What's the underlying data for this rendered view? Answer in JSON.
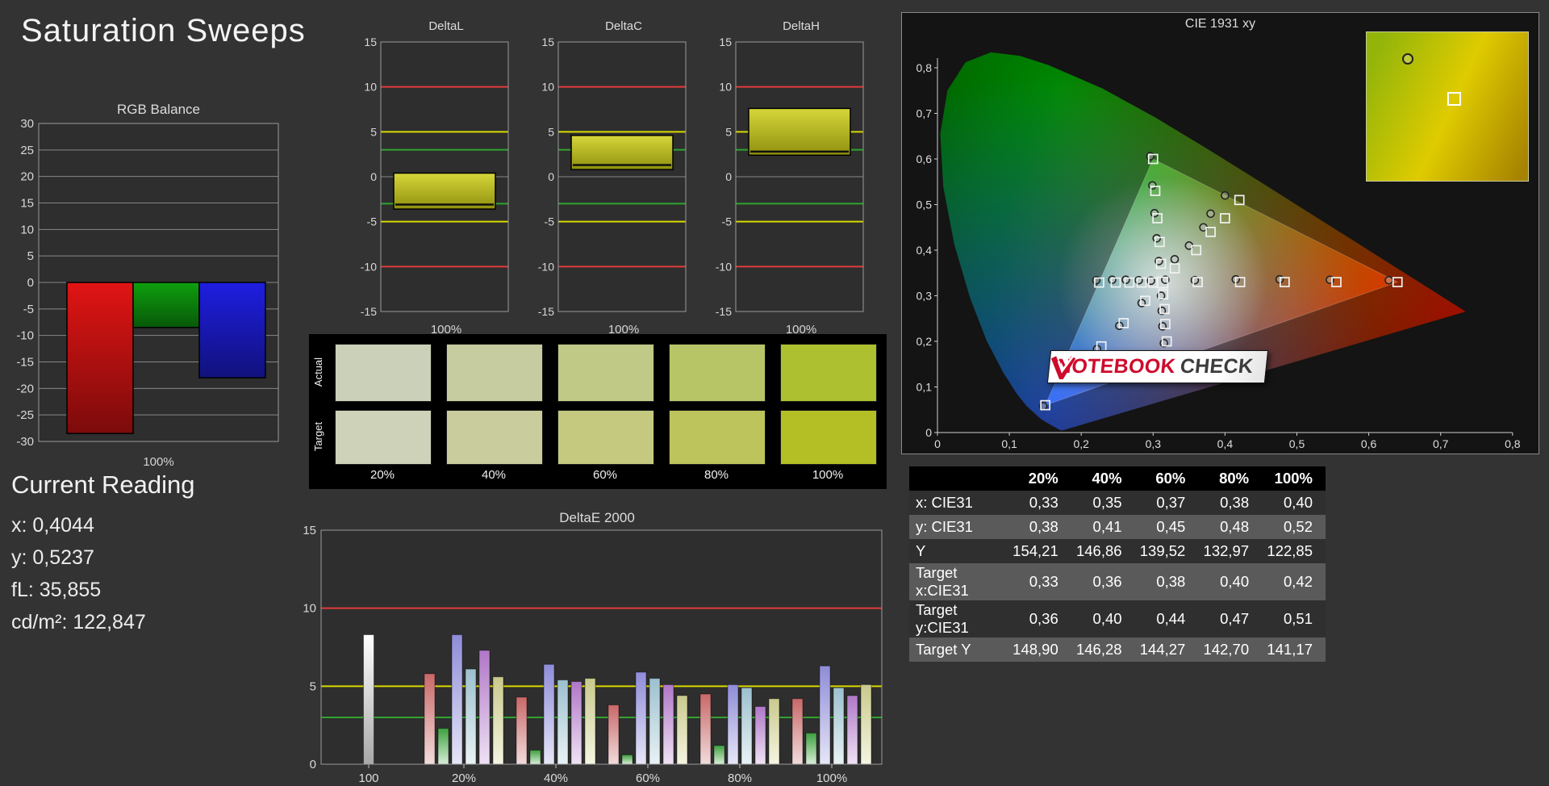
{
  "title": "Saturation Sweeps",
  "current_reading": {
    "heading": "Current Reading",
    "lines": [
      {
        "label": "x:",
        "value": "0,4044"
      },
      {
        "label": "y:",
        "value": "0,5237"
      },
      {
        "label": "fL:",
        "value": "35,855"
      },
      {
        "label": "cd/m²:",
        "value": "122,847"
      }
    ]
  },
  "swatch_panel": {
    "row_labels": [
      "Actual",
      "Target"
    ],
    "column_labels": [
      "20%",
      "40%",
      "60%",
      "80%",
      "100%"
    ],
    "actual_colors": [
      "#cbd1b8",
      "#c6cc9f",
      "#c0c985",
      "#b8c566",
      "#adc02f"
    ],
    "target_colors": [
      "#ced2b9",
      "#c9cc9c",
      "#c4c97f",
      "#bdc45b",
      "#b4bf25"
    ]
  },
  "results_table": {
    "header": [
      "",
      "20%",
      "40%",
      "60%",
      "80%",
      "100%"
    ],
    "rows": [
      {
        "label": "x: CIE31",
        "values": [
          "0,33",
          "0,35",
          "0,37",
          "0,38",
          "0,40"
        ]
      },
      {
        "label": "y: CIE31",
        "values": [
          "0,38",
          "0,41",
          "0,45",
          "0,48",
          "0,52"
        ]
      },
      {
        "label": "Y",
        "values": [
          "154,21",
          "146,86",
          "139,52",
          "132,97",
          "122,85"
        ]
      },
      {
        "label": "Target x:CIE31",
        "values": [
          "0,33",
          "0,36",
          "0,38",
          "0,40",
          "0,42"
        ]
      },
      {
        "label": "Target y:CIE31",
        "values": [
          "0,36",
          "0,40",
          "0,44",
          "0,47",
          "0,51"
        ]
      },
      {
        "label": "Target Y",
        "values": [
          "148,90",
          "146,28",
          "144,27",
          "142,70",
          "141,17"
        ]
      }
    ]
  },
  "logo": {
    "text_red": "NOTEBOOK",
    "text_dark": "CHECK",
    "red": "#cf0a2c"
  },
  "chart_data": [
    {
      "id": "rgb_balance",
      "type": "bar",
      "title": "RGB Balance",
      "xlabel": "100%",
      "categories": [
        "Red",
        "Green",
        "Blue"
      ],
      "values": [
        -28.5,
        -8.5,
        -18
      ],
      "bar_colors": [
        "#e11414",
        "#0ea00e",
        "#1e1ee1"
      ],
      "ylim": [
        -30,
        30
      ],
      "ytick_step": 5
    },
    {
      "id": "delta_l",
      "type": "range",
      "title": "DeltaL",
      "xlabel": "100%",
      "range_min": -3.6,
      "range_max": 0.4,
      "marker": -3.1,
      "ylim": [
        -15,
        15
      ],
      "ytick_step": 5,
      "box_color": "#c8c832",
      "ref_lines": [
        {
          "value": 10,
          "color": "#e23b3b"
        },
        {
          "value": -10,
          "color": "#e23b3b"
        },
        {
          "value": 5,
          "color": "#d9d900"
        },
        {
          "value": -5,
          "color": "#d9d900"
        },
        {
          "value": 3,
          "color": "#30a330"
        },
        {
          "value": -3,
          "color": "#30a330"
        }
      ]
    },
    {
      "id": "delta_c",
      "type": "range",
      "title": "DeltaC",
      "xlabel": "100%",
      "range_min": 0.8,
      "range_max": 4.6,
      "marker": 1.3,
      "ylim": [
        -15,
        15
      ],
      "ytick_step": 5,
      "box_color": "#c8c832",
      "ref_lines": [
        {
          "value": 10,
          "color": "#e23b3b"
        },
        {
          "value": -10,
          "color": "#e23b3b"
        },
        {
          "value": 5,
          "color": "#d9d900"
        },
        {
          "value": -5,
          "color": "#d9d900"
        },
        {
          "value": 3,
          "color": "#30a330"
        },
        {
          "value": -3,
          "color": "#30a330"
        }
      ]
    },
    {
      "id": "delta_h",
      "type": "range",
      "title": "DeltaH",
      "xlabel": "100%",
      "range_min": 2.4,
      "range_max": 7.6,
      "marker": 2.8,
      "ylim": [
        -15,
        15
      ],
      "ytick_step": 5,
      "box_color": "#c8c832",
      "ref_lines": [
        {
          "value": 10,
          "color": "#e23b3b"
        },
        {
          "value": -10,
          "color": "#e23b3b"
        },
        {
          "value": 5,
          "color": "#d9d900"
        },
        {
          "value": -5,
          "color": "#d9d900"
        },
        {
          "value": 3,
          "color": "#30a330"
        },
        {
          "value": -3,
          "color": "#30a330"
        }
      ]
    },
    {
      "id": "deltae_2000",
      "type": "grouped_bar",
      "title": "DeltaE 2000",
      "ylim": [
        0,
        15
      ],
      "yticks": [
        0,
        5,
        10,
        15
      ],
      "ref_lines": [
        {
          "value": 3,
          "color": "#30a330"
        },
        {
          "value": 5,
          "color": "#d9d900"
        },
        {
          "value": 10,
          "color": "#e23b3b"
        }
      ],
      "palette": {
        "white": [
          "#ffffff",
          "#a8a8a8"
        ],
        "red": [
          "#c96868",
          "#f2dcdc"
        ],
        "green": [
          "#3fa03f",
          "#d8eed8"
        ],
        "blue": [
          "#8f8cd8",
          "#e6e6f7"
        ],
        "cyan": [
          "#9cc0cf",
          "#e9f2f5"
        ],
        "magenta": [
          "#b077c7",
          "#efe2f4"
        ],
        "yellow": [
          "#c9c98d",
          "#f5f5e2"
        ]
      },
      "groups": [
        {
          "label": "100",
          "bars": [
            {
              "name": "white",
              "value": 8.3
            }
          ]
        },
        {
          "label": "20%",
          "bars": [
            {
              "name": "red",
              "value": 5.8
            },
            {
              "name": "green",
              "value": 2.3
            },
            {
              "name": "blue",
              "value": 8.3
            },
            {
              "name": "cyan",
              "value": 6.1
            },
            {
              "name": "magenta",
              "value": 7.3
            },
            {
              "name": "yellow",
              "value": 5.6
            }
          ]
        },
        {
          "label": "40%",
          "bars": [
            {
              "name": "red",
              "value": 4.3
            },
            {
              "name": "green",
              "value": 0.9
            },
            {
              "name": "blue",
              "value": 6.4
            },
            {
              "name": "cyan",
              "value": 5.4
            },
            {
              "name": "magenta",
              "value": 5.3
            },
            {
              "name": "yellow",
              "value": 5.5
            }
          ]
        },
        {
          "label": "60%",
          "bars": [
            {
              "name": "red",
              "value": 3.8
            },
            {
              "name": "green",
              "value": 0.6
            },
            {
              "name": "blue",
              "value": 5.9
            },
            {
              "name": "cyan",
              "value": 5.5
            },
            {
              "name": "magenta",
              "value": 5.1
            },
            {
              "name": "yellow",
              "value": 4.4
            }
          ]
        },
        {
          "label": "80%",
          "bars": [
            {
              "name": "red",
              "value": 4.5
            },
            {
              "name": "green",
              "value": 1.2
            },
            {
              "name": "blue",
              "value": 5.1
            },
            {
              "name": "cyan",
              "value": 4.9
            },
            {
              "name": "magenta",
              "value": 3.7
            },
            {
              "name": "yellow",
              "value": 4.2
            }
          ]
        },
        {
          "label": "100%",
          "bars": [
            {
              "name": "red",
              "value": 4.2
            },
            {
              "name": "green",
              "value": 2.0
            },
            {
              "name": "blue",
              "value": 6.3
            },
            {
              "name": "cyan",
              "value": 4.9
            },
            {
              "name": "magenta",
              "value": 4.4
            },
            {
              "name": "yellow",
              "value": 5.1
            }
          ]
        }
      ]
    },
    {
      "id": "cie_1931",
      "type": "scatter",
      "title": "CIE 1931 xy",
      "xlim": [
        0,
        0.8
      ],
      "ylim": [
        0,
        0.8
      ],
      "x_tick_labels": [
        "0",
        "0,1",
        "0,2",
        "0,3",
        "0,4",
        "0,5",
        "0,6",
        "0,7",
        "0,8"
      ],
      "y_tick_labels": [
        "0",
        "0,1",
        "0,2",
        "0,3",
        "0,4",
        "0,5",
        "0,6",
        "0,7",
        "0,8"
      ],
      "gamut_triangle": [
        [
          0.64,
          0.33
        ],
        [
          0.3,
          0.6
        ],
        [
          0.15,
          0.06
        ]
      ],
      "white_point": {
        "target": [
          0.313,
          0.329
        ],
        "measured": [
          0.317,
          0.335
        ]
      },
      "series": [
        {
          "name": "red",
          "targets": [
            [
              0.362,
              0.33
            ],
            [
              0.421,
              0.33
            ],
            [
              0.483,
              0.33
            ],
            [
              0.555,
              0.33
            ],
            [
              0.64,
              0.33
            ]
          ],
          "measured": [
            [
              0.358,
              0.334
            ],
            [
              0.415,
              0.336
            ],
            [
              0.476,
              0.336
            ],
            [
              0.546,
              0.335
            ],
            [
              0.628,
              0.334
            ]
          ]
        },
        {
          "name": "green",
          "targets": [
            [
              0.311,
              0.37
            ],
            [
              0.309,
              0.418
            ],
            [
              0.306,
              0.47
            ],
            [
              0.303,
              0.53
            ],
            [
              0.3,
              0.6
            ]
          ],
          "measured": [
            [
              0.308,
              0.376
            ],
            [
              0.305,
              0.426
            ],
            [
              0.302,
              0.481
            ],
            [
              0.299,
              0.542
            ],
            [
              0.296,
              0.606
            ]
          ]
        },
        {
          "name": "blue",
          "targets": [
            [
              0.289,
              0.289
            ],
            [
              0.259,
              0.24
            ],
            [
              0.228,
              0.189
            ],
            [
              0.192,
              0.13
            ],
            [
              0.15,
              0.06
            ]
          ],
          "measured": [
            [
              0.284,
              0.284
            ],
            [
              0.253,
              0.234
            ],
            [
              0.222,
              0.183
            ],
            [
              0.186,
              0.124
            ],
            [
              0.147,
              0.058
            ]
          ]
        },
        {
          "name": "cyan",
          "targets": [
            [
              0.3,
              0.329
            ],
            [
              0.284,
              0.329
            ],
            [
              0.267,
              0.329
            ],
            [
              0.248,
              0.329
            ],
            [
              0.225,
              0.329
            ]
          ],
          "measured": [
            [
              0.297,
              0.333
            ],
            [
              0.28,
              0.334
            ],
            [
              0.262,
              0.335
            ],
            [
              0.243,
              0.335
            ],
            [
              0.221,
              0.334
            ]
          ]
        },
        {
          "name": "magenta",
          "targets": [
            [
              0.314,
              0.303
            ],
            [
              0.316,
              0.271
            ],
            [
              0.317,
              0.238
            ],
            [
              0.319,
              0.2
            ],
            [
              0.321,
              0.154
            ]
          ],
          "measured": [
            [
              0.311,
              0.3
            ],
            [
              0.312,
              0.267
            ],
            [
              0.313,
              0.233
            ],
            [
              0.315,
              0.196
            ],
            [
              0.318,
              0.151
            ]
          ]
        },
        {
          "name": "yellow",
          "targets": [
            [
              0.33,
              0.36
            ],
            [
              0.36,
              0.4
            ],
            [
              0.38,
              0.44
            ],
            [
              0.4,
              0.47
            ],
            [
              0.42,
              0.51
            ]
          ],
          "measured": [
            [
              0.33,
              0.38
            ],
            [
              0.35,
              0.41
            ],
            [
              0.37,
              0.45
            ],
            [
              0.38,
              0.48
            ],
            [
              0.4,
              0.52
            ]
          ]
        }
      ],
      "inset": {
        "marker_circle": [
          0.22,
          0.14
        ],
        "marker_square": [
          0.5,
          0.4
        ],
        "gradient_colors": [
          "#93b50a",
          "#dfcb00",
          "#a68200"
        ]
      }
    }
  ]
}
